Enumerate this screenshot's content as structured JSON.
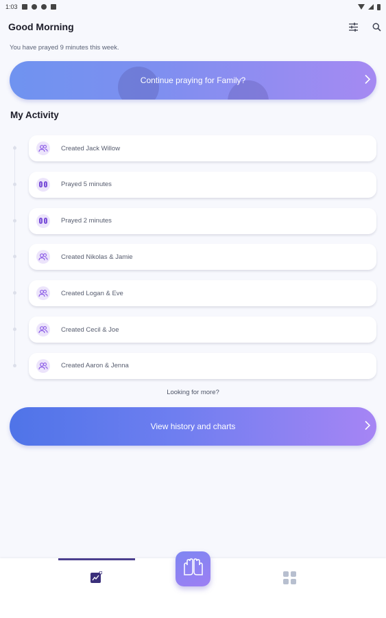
{
  "status_bar": {
    "time": "1:03"
  },
  "header": {
    "greeting": "Good Morning",
    "icons": [
      "filter-icon",
      "search-icon"
    ]
  },
  "subtitle": "You have prayed 9 minutes this week.",
  "continue_banner": {
    "label": "Continue praying for Family?"
  },
  "section_title": "My Activity",
  "activities": [
    {
      "text": "Created Jack Willow",
      "icon": "people-icon"
    },
    {
      "text": "Prayed 5 minutes",
      "icon": "praying-hands-icon"
    },
    {
      "text": "Prayed 2 minutes",
      "icon": "praying-hands-icon"
    },
    {
      "text": "Created Nikolas & Jamie",
      "icon": "people-icon"
    },
    {
      "text": "Created Logan & Eve",
      "icon": "people-icon"
    },
    {
      "text": "Created Cecil & Joe",
      "icon": "people-icon"
    },
    {
      "text": "Created Aaron & Jenna",
      "icon": "people-icon"
    }
  ],
  "more_link": "Looking for more?",
  "history_banner": {
    "label": "View history and charts"
  },
  "bottom_nav": {
    "tabs": [
      "activity-chart-icon",
      "praying-hands-icon",
      "grid-icon"
    ],
    "active_tab": "activity-chart-icon"
  },
  "colors": {
    "accent": "#4b3f8e",
    "banner_start": "#4f74e8",
    "banner_end": "#a685f4",
    "icon_bg": "#ece4fb"
  }
}
